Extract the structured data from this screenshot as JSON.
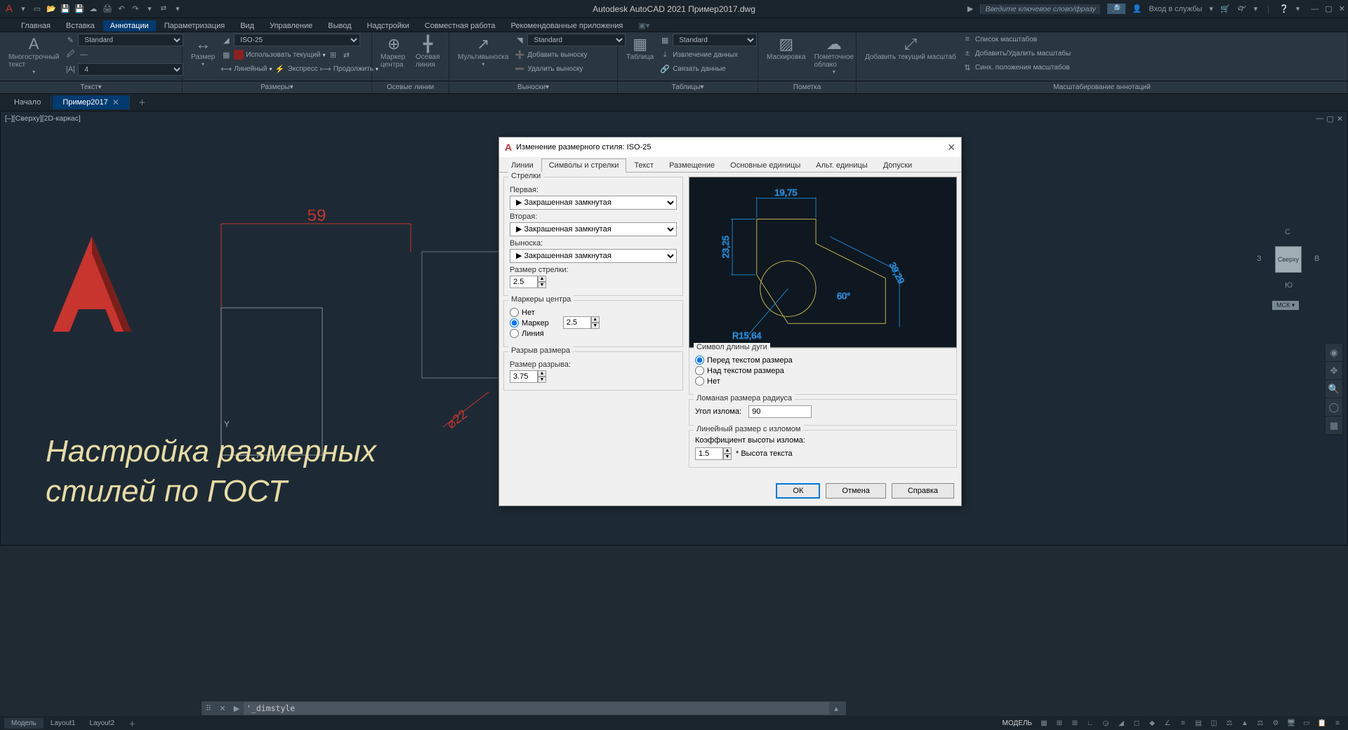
{
  "app": {
    "title": "Autodesk AutoCAD 2021   Пример2017.dwg"
  },
  "titlebar": {
    "search_placeholder": "Введите ключевое слово/фразу",
    "login_label": "Вход в службы"
  },
  "menu": {
    "tabs": [
      "Главная",
      "Вставка",
      "Аннотации",
      "Параметризация",
      "Вид",
      "Управление",
      "Вывод",
      "Надстройки",
      "Совместная работа",
      "Рекомендованные приложения"
    ],
    "active_index": 2
  },
  "ribbon": {
    "text_panel": {
      "big": "Многострочный текст",
      "style": "Standard",
      "height": "4"
    },
    "dim_panel": {
      "big": "Размер",
      "style": "ISO-25",
      "use_current": "Использовать текущий",
      "linear": "Линейный",
      "express": "Экспресс",
      "continue": "Продолжить"
    },
    "centerlines": {
      "marker": "Маркер центра",
      "axis": "Осевая линия"
    },
    "leader_panel": {
      "big": "Мультивыноска",
      "style": "Standard",
      "add": "Добавить выноску",
      "remove": "Удалить выноску"
    },
    "table_panel": {
      "big": "Таблица",
      "style": "Standard",
      "extract": "Извлечение данных",
      "link": "Связать данные"
    },
    "markup_panel": {
      "mask": "Маскировка",
      "cloud": "Пометочное облако"
    },
    "scale_panel": {
      "add": "Добавить текущий масштаб",
      "list": "Список масштабов",
      "addrem": "Добавить/Удалить масштабы",
      "sync": "Синх. положения масштабов"
    },
    "labels": [
      "Текст",
      "Размеры",
      "Осевые линии",
      "Выноски",
      "Таблицы",
      "Пометка",
      "Масштабирование аннотаций"
    ]
  },
  "filetabs": {
    "tabs": [
      "Начало",
      "Пример2017"
    ],
    "active_index": 1
  },
  "viewport": {
    "label": "[–][Сверху][2D-каркас]"
  },
  "drawing": {
    "dim59": "59",
    "dia22": "⌀22"
  },
  "overlay": {
    "line1": "Настройка размерных",
    "line2": "стилей по ГОСТ"
  },
  "navcube": {
    "n": "С",
    "s": "Ю",
    "e": "В",
    "w": "З",
    "face": "Сверху",
    "msk": "МСК"
  },
  "dialog": {
    "title": "Изменение размерного стиля: ISO-25",
    "tabs": [
      "Линии",
      "Символы и стрелки",
      "Текст",
      "Размещение",
      "Основные единицы",
      "Альт. единицы",
      "Допуски"
    ],
    "active_tab": 1,
    "arrows": {
      "group": "Стрелки",
      "first_lbl": "Первая:",
      "first_val": "Закрашенная замкнутая",
      "second_lbl": "Вторая:",
      "second_val": "Закрашенная замкнутая",
      "leader_lbl": "Выноска:",
      "leader_val": "Закрашенная замкнутая",
      "size_lbl": "Размер стрелки:",
      "size_val": "2.5"
    },
    "center": {
      "group": "Маркеры центра",
      "none": "Нет",
      "marker": "Маркер",
      "line": "Линия",
      "val": "2.5"
    },
    "break": {
      "group": "Разрыв размера",
      "size_lbl": "Размер разрыва:",
      "size_val": "3.75"
    },
    "arc": {
      "group": "Символ длины дуги",
      "before": "Перед текстом размера",
      "above": "Над текстом размера",
      "none": "Нет"
    },
    "jog_radius": {
      "group": "Ломаная размера радиуса",
      "angle_lbl": "Угол излома:",
      "angle_val": "90"
    },
    "jog_linear": {
      "group": "Линейный размер с изломом",
      "factor_lbl": "Коэффициент высоты излома:",
      "factor_val": "1.5",
      "suffix": "* Высота текста"
    },
    "preview": {
      "d1": "19,75",
      "d2": "23,25",
      "d3": "39,29",
      "ang": "60°",
      "rad": "R15,64"
    },
    "buttons": {
      "ok": "ОК",
      "cancel": "Отмена",
      "help": "Справка"
    }
  },
  "cmdline": {
    "text": "'_dimstyle"
  },
  "statusbar": {
    "tabs": [
      "Модель",
      "Layout1",
      "Layout2"
    ],
    "active_index": 0,
    "model": "МОДЕЛЬ"
  }
}
